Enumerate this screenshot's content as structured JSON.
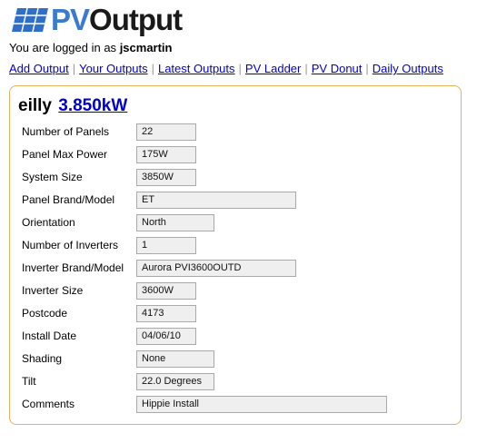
{
  "header": {
    "logo_pv": "PV",
    "logo_output": "Output"
  },
  "login": {
    "prefix": "You are logged in as",
    "username": "jscmartin"
  },
  "nav": [
    "Add Output",
    "Your Outputs",
    "Latest Outputs",
    "PV Ladder",
    "PV Donut",
    "Daily Outputs"
  ],
  "system": {
    "name": "eilly",
    "size_link": "3.850kW"
  },
  "fields": [
    {
      "label": "Number of Panels",
      "value": "22"
    },
    {
      "label": "Panel Max Power",
      "value": "175W"
    },
    {
      "label": "System Size",
      "value": "3850W"
    },
    {
      "label": "Panel Brand/Model",
      "value": "ET"
    },
    {
      "label": "Orientation",
      "value": "North"
    },
    {
      "label": "Number of Inverters",
      "value": "1"
    },
    {
      "label": "Inverter Brand/Model",
      "value": "Aurora PVI3600OUTD"
    },
    {
      "label": "Inverter Size",
      "value": "3600W"
    },
    {
      "label": "Postcode",
      "value": "4173"
    },
    {
      "label": "Install Date",
      "value": "04/06/10"
    },
    {
      "label": "Shading",
      "value": "None"
    },
    {
      "label": "Tilt",
      "value": "22.0 Degrees"
    },
    {
      "label": "Comments",
      "value": "Hippie Install"
    }
  ]
}
